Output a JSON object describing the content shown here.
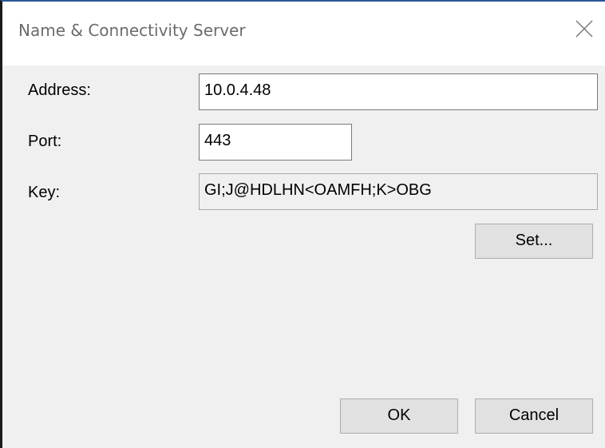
{
  "dialog": {
    "title": "Name & Connectivity Server",
    "close_icon": "close-icon"
  },
  "form": {
    "address_label": "Address:",
    "address_value": "10.0.4.48",
    "port_label": "Port:",
    "port_value": "443",
    "key_label": "Key:",
    "key_value": "GI;J@HDLHN<OAMFH;K>OBG"
  },
  "buttons": {
    "set_label": "Set...",
    "ok_label": "OK",
    "cancel_label": "Cancel"
  }
}
